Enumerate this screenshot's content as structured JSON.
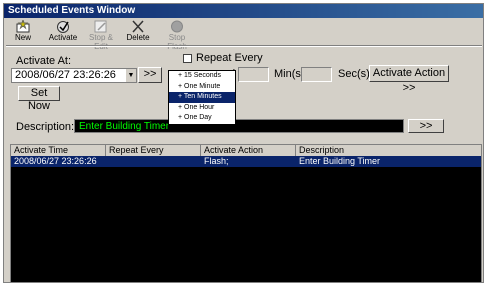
{
  "window": {
    "title": "Scheduled Events Window"
  },
  "toolbar": {
    "new_label": "New",
    "activate_label": "Activate",
    "stop_edit_label": "Stop & Edit",
    "delete_label": "Delete",
    "stop_flash_label": "Stop Flash"
  },
  "form": {
    "activate_at_label": "Activate At:",
    "activate_at_value": "2008/06/27 23:26:26",
    "repeat_every_label": "Repeat Every",
    "repeat_paren": ")",
    "min_label": "Min(s)",
    "sec_label": "Sec(s)",
    "activate_action_label": "Activate Action >>",
    "arrow_button_label": ">>",
    "set_now_label": "Set Now",
    "description_label": "Description:",
    "description_value": "Enter Building Timer",
    "desc_arrow_label": ">>"
  },
  "repeat_dropdown": {
    "items": [
      "+ 15 Seconds",
      "+ One Minute",
      "+ Ten Minutes",
      "+ One Hour",
      "+ One Day"
    ],
    "selected_index": 2
  },
  "events_table": {
    "columns": [
      "Activate Time",
      "Repeat Every",
      "Activate Action",
      "Description"
    ],
    "rows": [
      {
        "activate_time": "2008/06/27 23:26:26",
        "repeat_every": "",
        "activate_action": "Flash;",
        "description": "Enter Building Timer"
      }
    ]
  },
  "colors": {
    "selection": "#0a246a",
    "description_text": "#00ff00",
    "list_background": "#000000"
  }
}
